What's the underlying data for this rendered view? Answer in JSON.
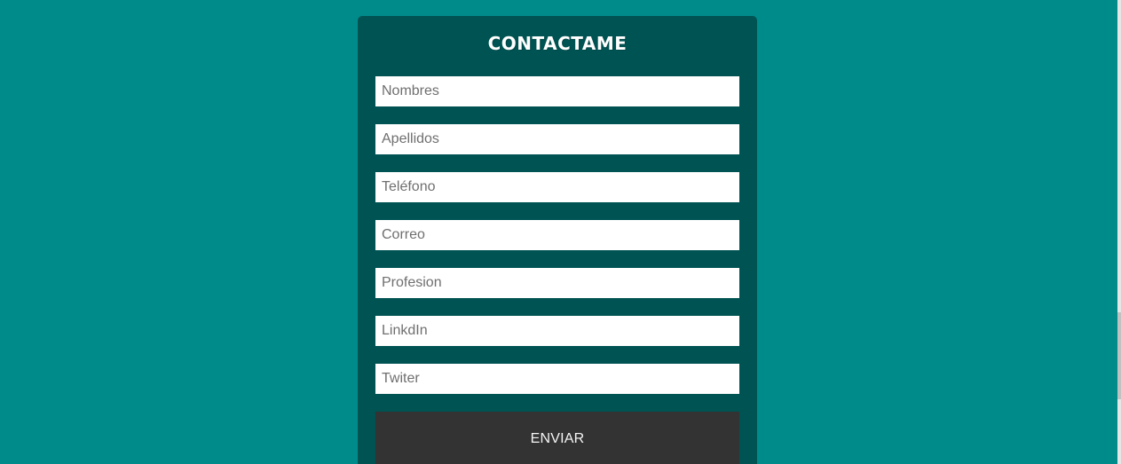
{
  "form": {
    "title": "CONTACTAME",
    "fields": [
      {
        "placeholder": "Nombres",
        "value": ""
      },
      {
        "placeholder": "Apellidos",
        "value": ""
      },
      {
        "placeholder": "Teléfono",
        "value": ""
      },
      {
        "placeholder": "Correo",
        "value": ""
      },
      {
        "placeholder": "Profesion",
        "value": ""
      },
      {
        "placeholder": "LinkdIn",
        "value": ""
      },
      {
        "placeholder": "Twiter",
        "value": ""
      }
    ],
    "submit_label": "ENVIAR"
  },
  "colors": {
    "page_background": "#008b8b",
    "card_background": "#005353",
    "button_background": "#333333",
    "input_background": "#ffffff",
    "title_text": "#ffffff"
  }
}
